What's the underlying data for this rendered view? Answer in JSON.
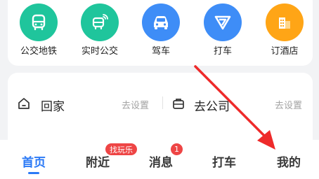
{
  "services": [
    {
      "label": "公交地铁",
      "icon": "bus-icon",
      "color": "#1fc59c"
    },
    {
      "label": "实时公交",
      "icon": "realtime-bus-icon",
      "color": "#1fc59c"
    },
    {
      "label": "驾车",
      "icon": "car-icon",
      "color": "#3e8df7"
    },
    {
      "label": "打车",
      "icon": "taxi-icon",
      "color": "#3e8df7"
    },
    {
      "label": "订酒店",
      "icon": "hotel-icon",
      "color": "#ffa516"
    }
  ],
  "destinations": {
    "home": {
      "label": "回家",
      "action": "去设置",
      "icon": "home-icon"
    },
    "work": {
      "label": "去公司",
      "action": "去设置",
      "icon": "briefcase-icon"
    }
  },
  "tabbar": {
    "tabs": [
      {
        "label": "首页",
        "active": true
      },
      {
        "label": "附近",
        "badge": "找玩乐"
      },
      {
        "label": "消息",
        "badge": "1"
      },
      {
        "label": "打车"
      },
      {
        "label": "我的"
      }
    ]
  },
  "colors": {
    "accent": "#2a79f6",
    "badge": "#ee4545",
    "annotation_arrow": "#ee2a2a"
  }
}
